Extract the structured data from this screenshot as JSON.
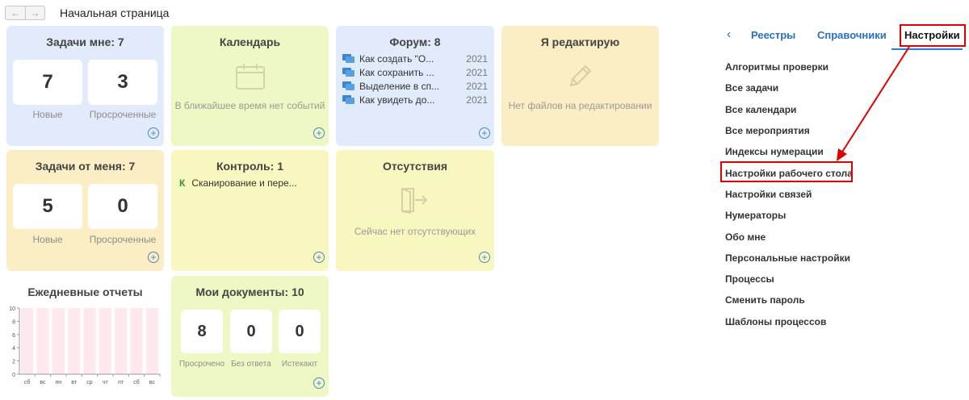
{
  "header": {
    "back_icon": "arrow-left-icon",
    "forward_icon": "arrow-right-icon",
    "title": "Начальная страница"
  },
  "tiles": {
    "tasks_to_me": {
      "title": "Задачи мне: 7",
      "new_count": "7",
      "new_label": "Новые",
      "overdue_count": "3",
      "overdue_label": "Просроченные"
    },
    "calendar": {
      "title": "Календарь",
      "message": "В ближайшее время нет событий"
    },
    "forum": {
      "title": "Форум: 8",
      "items": [
        {
          "title": "Как создать \"О...",
          "year": "2021"
        },
        {
          "title": "Как сохранить ...",
          "year": "2021"
        },
        {
          "title": "Выделение в сп...",
          "year": "2021"
        },
        {
          "title": "Как увидеть до...",
          "year": "2021"
        }
      ]
    },
    "editing": {
      "title": "Я редактирую",
      "message": "Нет файлов на редактировании"
    },
    "tasks_from_me": {
      "title": "Задачи от меня: 7",
      "new_count": "5",
      "new_label": "Новые",
      "overdue_count": "0",
      "overdue_label": "Просроченные"
    },
    "control": {
      "title": "Контроль: 1",
      "items": [
        {
          "marker": "К",
          "title": "Сканирование и пере..."
        }
      ]
    },
    "absences": {
      "title": "Отсутствия",
      "message": "Сейчас нет отсутствующих"
    },
    "daily_reports": {
      "title": "Ежедневные отчеты"
    },
    "my_documents": {
      "title": "Мои документы: 10",
      "overdue": "8",
      "overdue_label": "Просрочено",
      "no_answer": "0",
      "no_answer_label": "Без ответа",
      "expiring": "0",
      "expiring_label": "Истекают"
    }
  },
  "chart_data": {
    "type": "bar",
    "title": "Ежедневные отчеты",
    "categories": [
      "сб",
      "вс",
      "пн",
      "вт",
      "ср",
      "чт",
      "пт",
      "сб",
      "вс"
    ],
    "values": [
      0,
      0,
      0,
      0,
      0,
      0,
      0,
      0,
      0
    ],
    "yticks": [
      "10",
      "8",
      "6",
      "4",
      "2",
      "0"
    ],
    "ylim": [
      0,
      10
    ],
    "grid": true
  },
  "right_panel": {
    "tabs": [
      "Реестры",
      "Справочники",
      "Настройки"
    ],
    "active_tab": "Настройки",
    "items": [
      "Алгоритмы проверки",
      "Все задачи",
      "Все календари",
      "Все мероприятия",
      "Индексы нумерации",
      "Настройки рабочего стола",
      "Настройки связей",
      "Нумераторы",
      "Обо мне",
      "Персональные настройки",
      "Процессы",
      "Сменить пароль",
      "Шаблоны процессов"
    ],
    "highlighted_item": "Настройки рабочего стола"
  },
  "colors": {
    "accent": "#2d7cd6",
    "highlight": "#e00000",
    "blue_tile": "#e2ebfb",
    "green_tile": "#eef8c4",
    "yellow_tile": "#f9f7c0",
    "orange_tile": "#fbeec4"
  }
}
